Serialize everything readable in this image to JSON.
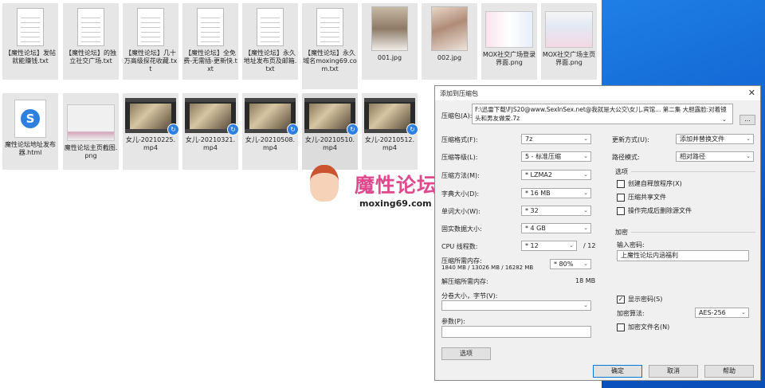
{
  "files_row1": [
    {
      "label": "【魔性论坛】发帖就能赚钱.txt",
      "icon": "text-file-icon"
    },
    {
      "label": "【魔性论坛】的独立社交广场.txt",
      "icon": "text-file-icon"
    },
    {
      "label": "【魔性论坛】几十万高级探花收藏.txt",
      "icon": "text-file-icon"
    },
    {
      "label": "【魔性论坛】全免费-无需插-更新快.txt",
      "icon": "text-file-icon"
    },
    {
      "label": "【魔性论坛】永久地址发布页及邮箱.txt",
      "icon": "text-file-icon"
    },
    {
      "label": "【魔性论坛】永久域名moxing69.com.txt",
      "icon": "text-file-icon"
    },
    {
      "label": "001.jpg",
      "icon": "image-file-icon"
    },
    {
      "label": "002.jpg",
      "icon": "image-file-icon"
    },
    {
      "label": "MOX社交广场登录界面.png",
      "icon": "image-file-icon"
    },
    {
      "label": "MOX社交广场主页界面.png",
      "icon": "image-file-icon"
    }
  ],
  "files_row2": [
    {
      "label": "魔性论坛地址发布器.html",
      "icon": "html-file-icon"
    },
    {
      "label": "魔性论坛主页截图.png",
      "icon": "image-file-icon"
    },
    {
      "label": "女儿-20210225.mp4",
      "icon": "video-file-icon"
    },
    {
      "label": "女儿-20210321.mp4",
      "icon": "video-file-icon"
    },
    {
      "label": "女儿-20210508.mp4",
      "icon": "video-file-icon"
    },
    {
      "label": "女儿-20210510.mp4",
      "icon": "video-file-icon"
    },
    {
      "label": "女儿-20210512.mp4",
      "icon": "video-file-icon"
    }
  ],
  "watermark": {
    "title": "魔性论坛",
    "url": "moxing69.com"
  },
  "dialog": {
    "title": "添加到压缩包",
    "archive_label": "压缩包(A):",
    "archive_value": "F:\\迅雷下载\\FJS20@www.SexInSex.net@我就是大公交\\女儿.宾馆... 第二集 大胆露脸:对着镜头和男友做爱.7z",
    "browse_label": "...",
    "format_label": "压缩格式(F):",
    "format_value": "7z",
    "level_label": "压缩等级(L):",
    "level_value": "5 - 标准压缩",
    "method_label": "压缩方法(M):",
    "method_value": "* LZMA2",
    "dict_label": "字典大小(D):",
    "dict_value": "* 16 MB",
    "word_label": "单词大小(W):",
    "word_value": "* 32",
    "solid_label": "固实数据大小:",
    "solid_value": "* 4 GB",
    "cpu_label": "CPU 线程数:",
    "cpu_value": "* 12",
    "cpu_total": "/ 12",
    "mem_label": "压缩所需内存:",
    "mem_detail": "1840 MB / 13026 MB / 16282 MB",
    "mem_value": "* 80%",
    "decomp_label": "解压缩所需内存:",
    "decomp_value": "18 MB",
    "split_label": "分卷大小，字节(V):",
    "split_value": "",
    "params_label": "参数(P):",
    "options_button": "选项",
    "update_label": "更新方式(U):",
    "update_value": "添加并替换文件",
    "pathmode_label": "路径模式:",
    "pathmode_value": "相对路径",
    "options_group": "选项",
    "opt_sfx": "创建自释放程序(X)",
    "opt_shared": "压缩共享文件",
    "opt_delete": "操作完成后删除源文件",
    "encrypt_group": "加密",
    "password_label": "输入密码:",
    "password_value": "上魔性论坛内涵福利",
    "show_password": "显示密码(S)",
    "encrypt_method_label": "加密算法:",
    "encrypt_method_value": "AES-256",
    "encrypt_names": "加密文件名(N)",
    "ok": "确定",
    "cancel": "取消",
    "help": "帮助"
  }
}
